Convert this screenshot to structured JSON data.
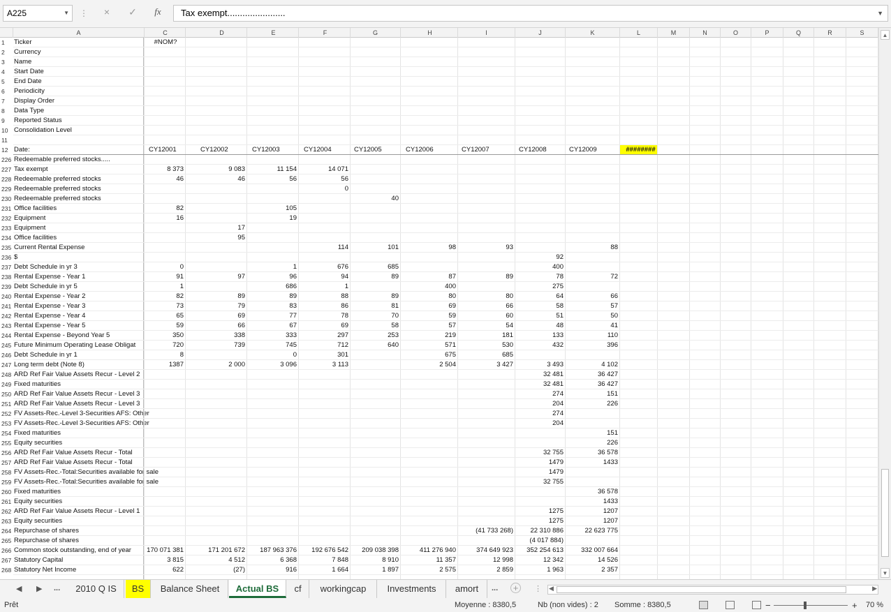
{
  "formula_bar": {
    "name_box": "A225",
    "cancel_icon": "×",
    "confirm_icon": "✓",
    "function_icon": "fx",
    "formula": "Tax exempt......................."
  },
  "columns": [
    "A",
    "C",
    "D",
    "E",
    "F",
    "G",
    "H",
    "I",
    "J",
    "K",
    "L",
    "M",
    "N",
    "O",
    "P",
    "Q",
    "R",
    "S"
  ],
  "rows": [
    {
      "n": "1",
      "a": "Ticker",
      "v": {
        "C": "#NOM?"
      }
    },
    {
      "n": "2",
      "a": "Currency",
      "v": {}
    },
    {
      "n": "3",
      "a": "Name",
      "v": {}
    },
    {
      "n": "4",
      "a": "Start Date",
      "v": {}
    },
    {
      "n": "5",
      "a": "End Date",
      "v": {}
    },
    {
      "n": "6",
      "a": "Periodicity",
      "v": {}
    },
    {
      "n": "7",
      "a": "Display Order",
      "v": {}
    },
    {
      "n": "8",
      "a": "Data Type",
      "v": {}
    },
    {
      "n": "9",
      "a": "Reported Status",
      "v": {}
    },
    {
      "n": "10",
      "a": "Consolidation Level",
      "v": {}
    },
    {
      "n": "11",
      "a": "",
      "v": {}
    },
    {
      "n": "12",
      "a": "Date:",
      "v": {
        "C": "CY12001",
        "D": "CY12002",
        "E": "CY12003",
        "F": "CY12004",
        "G": "CY12005",
        "H": "CY12006",
        "I": "CY12007",
        "J": "CY12008",
        "K": "CY12009",
        "L": "########"
      }
    },
    {
      "n": "226",
      "a": "Redeemable preferred stocks.....",
      "v": {}
    },
    {
      "n": "227",
      "a": "Tax exempt",
      "v": {
        "C": "8 373",
        "D": "9 083",
        "E": "11 154",
        "F": "14 071"
      }
    },
    {
      "n": "228",
      "a": "Redeemable preferred stocks",
      "v": {
        "C": "46",
        "D": "46",
        "E": "56",
        "F": "56"
      }
    },
    {
      "n": "229",
      "a": "Redeemable preferred stocks",
      "v": {
        "F": "0"
      }
    },
    {
      "n": "230",
      "a": "Redeemable preferred stocks",
      "v": {
        "G": "40"
      }
    },
    {
      "n": "231",
      "a": "Office facilities",
      "v": {
        "C": "82",
        "E": "105"
      }
    },
    {
      "n": "232",
      "a": "Equipment",
      "v": {
        "C": "16",
        "E": "19"
      }
    },
    {
      "n": "233",
      "a": "Equipment",
      "v": {
        "D": "17"
      }
    },
    {
      "n": "234",
      "a": "Office facilities",
      "v": {
        "D": "95"
      }
    },
    {
      "n": "235",
      "a": "Current Rental Expense",
      "v": {
        "F": "114",
        "G": "101",
        "H": "98",
        "I": "93",
        "K": "88"
      }
    },
    {
      "n": "236",
      "a": "$",
      "v": {
        "J": "92"
      }
    },
    {
      "n": "237",
      "a": "Debt Schedule in yr 3",
      "v": {
        "C": "0",
        "E": "1",
        "F": "676",
        "G": "685",
        "J": "400"
      }
    },
    {
      "n": "238",
      "a": "Rental Expense - Year 1",
      "v": {
        "C": "91",
        "D": "97",
        "E": "96",
        "F": "94",
        "G": "89",
        "H": "87",
        "I": "89",
        "J": "78",
        "K": "72"
      }
    },
    {
      "n": "239",
      "a": "Debt Schedule in yr 5",
      "v": {
        "C": "1",
        "E": "686",
        "F": "1",
        "H": "400",
        "J": "275"
      }
    },
    {
      "n": "240",
      "a": "Rental Expense - Year 2",
      "v": {
        "C": "82",
        "D": "89",
        "E": "89",
        "F": "88",
        "G": "89",
        "H": "80",
        "I": "80",
        "J": "64",
        "K": "66"
      }
    },
    {
      "n": "241",
      "a": "Rental Expense - Year 3",
      "v": {
        "C": "73",
        "D": "79",
        "E": "83",
        "F": "86",
        "G": "81",
        "H": "69",
        "I": "66",
        "J": "58",
        "K": "57"
      }
    },
    {
      "n": "242",
      "a": "Rental Expense - Year 4",
      "v": {
        "C": "65",
        "D": "69",
        "E": "77",
        "F": "78",
        "G": "70",
        "H": "59",
        "I": "60",
        "J": "51",
        "K": "50"
      }
    },
    {
      "n": "243",
      "a": "Rental Expense - Year 5",
      "v": {
        "C": "59",
        "D": "66",
        "E": "67",
        "F": "69",
        "G": "58",
        "H": "57",
        "I": "54",
        "J": "48",
        "K": "41"
      }
    },
    {
      "n": "244",
      "a": "Rental Expense - Beyond Year 5",
      "v": {
        "C": "350",
        "D": "338",
        "E": "333",
        "F": "297",
        "G": "253",
        "H": "219",
        "I": "181",
        "J": "133",
        "K": "110"
      }
    },
    {
      "n": "245",
      "a": "Future Minimum Operating Lease Obligat",
      "v": {
        "C": "720",
        "D": "739",
        "E": "745",
        "F": "712",
        "G": "640",
        "H": "571",
        "I": "530",
        "J": "432",
        "K": "396"
      }
    },
    {
      "n": "246",
      "a": "Debt Schedule in yr 1",
      "v": {
        "C": "8",
        "E": "0",
        "F": "301",
        "H": "675",
        "I": "685"
      }
    },
    {
      "n": "247",
      "a": "Long term debt (Note 8)",
      "v": {
        "C": "1387",
        "D": "2 000",
        "E": "3 096",
        "F": "3 113",
        "H": "2 504",
        "I": "3 427",
        "J": "3 493",
        "K": "4 102"
      }
    },
    {
      "n": "248",
      "a": "ARD Ref Fair Value Assets Recur - Level 2",
      "v": {
        "J": "32 481",
        "K": "36 427"
      }
    },
    {
      "n": "249",
      "a": "Fixed maturities",
      "v": {
        "J": "32 481",
        "K": "36 427"
      }
    },
    {
      "n": "250",
      "a": "ARD Ref Fair Value Assets Recur - Level 3",
      "v": {
        "J": "274",
        "K": "151"
      }
    },
    {
      "n": "251",
      "a": "ARD Ref Fair Value Assets Recur - Level 3",
      "v": {
        "J": "204",
        "K": "226"
      }
    },
    {
      "n": "252",
      "a": "FV Assets-Rec.-Level 3-Securities AFS: Other",
      "v": {
        "J": "274"
      }
    },
    {
      "n": "253",
      "a": "FV Assets-Rec.-Level 3-Securities AFS: Other",
      "v": {
        "J": "204"
      }
    },
    {
      "n": "254",
      "a": "Fixed maturities",
      "v": {
        "K": "151"
      }
    },
    {
      "n": "255",
      "a": "Equity securities",
      "v": {
        "K": "226"
      }
    },
    {
      "n": "256",
      "a": "ARD Ref Fair Value Assets Recur - Total",
      "v": {
        "J": "32 755",
        "K": "36 578"
      }
    },
    {
      "n": "257",
      "a": "ARD Ref Fair Value Assets Recur - Total",
      "v": {
        "J": "1479",
        "K": "1433"
      }
    },
    {
      "n": "258",
      "a": "FV Assets-Rec.-Total:Securities available for sale",
      "v": {
        "J": "1479"
      }
    },
    {
      "n": "259",
      "a": "FV Assets-Rec.-Total:Securities available for sale",
      "v": {
        "J": "32 755"
      }
    },
    {
      "n": "260",
      "a": "Fixed maturities",
      "v": {
        "K": "36 578"
      }
    },
    {
      "n": "261",
      "a": "Equity securities",
      "v": {
        "K": "1433"
      }
    },
    {
      "n": "262",
      "a": "ARD Ref Fair Value Assets Recur - Level 1",
      "v": {
        "J": "1275",
        "K": "1207"
      }
    },
    {
      "n": "263",
      "a": "Equity securities",
      "v": {
        "J": "1275",
        "K": "1207"
      }
    },
    {
      "n": "264",
      "a": "Repurchase of shares",
      "v": {
        "I": "(41 733 268)",
        "J": "22 310 886",
        "K": "22 623 775"
      }
    },
    {
      "n": "265",
      "a": "Repurchase of shares",
      "v": {
        "J": "(4 017 884)"
      }
    },
    {
      "n": "266",
      "a": "Common stock outstanding, end of year",
      "v": {
        "C": "170 071 381",
        "D": "171 201 672",
        "E": "187 963 376",
        "F": "192 676 542",
        "G": "209 038 398",
        "H": "411 276 940",
        "I": "374 649 923",
        "J": "352 254 613",
        "K": "332 007 664"
      }
    },
    {
      "n": "267",
      "a": "Statutory Capital",
      "v": {
        "C": "3 815",
        "D": "4 512",
        "E": "6 368",
        "F": "7 848",
        "G": "8 910",
        "H": "11 357",
        "I": "12 998",
        "J": "12 342",
        "K": "14 526"
      }
    },
    {
      "n": "268",
      "a": "Statutory Net Income",
      "v": {
        "C": "622",
        "D": "(27)",
        "E": "916",
        "F": "1 664",
        "G": "1 897",
        "H": "2 575",
        "I": "2 859",
        "J": "1 963",
        "K": "2 357"
      }
    }
  ],
  "sheet_tabs": [
    {
      "label": "2010 Q IS",
      "state": "normal"
    },
    {
      "label": "BS",
      "state": "yellow"
    },
    {
      "label": "Balance Sheet",
      "state": "normal"
    },
    {
      "label": "Actual BS",
      "state": "active"
    },
    {
      "label": "cf",
      "state": "normal"
    },
    {
      "label": "workingcap",
      "state": "normal"
    },
    {
      "label": "Investments",
      "state": "normal"
    },
    {
      "label": "amort",
      "state": "normal"
    }
  ],
  "tab_nav": {
    "prev": "◀",
    "next": "▶",
    "more_left": "...",
    "more_right": "...",
    "add": "+"
  },
  "status_bar": {
    "ready": "Prêt",
    "average": "Moyenne : 8380,5",
    "count": "Nb (non vides) : 2",
    "sum": "Somme : 8380,5",
    "zoom_minus": "−",
    "zoom_plus": "+",
    "zoom": "70 %"
  },
  "colors": {
    "highlight": "#ffff00",
    "active_tab": "#1e6c3a"
  }
}
